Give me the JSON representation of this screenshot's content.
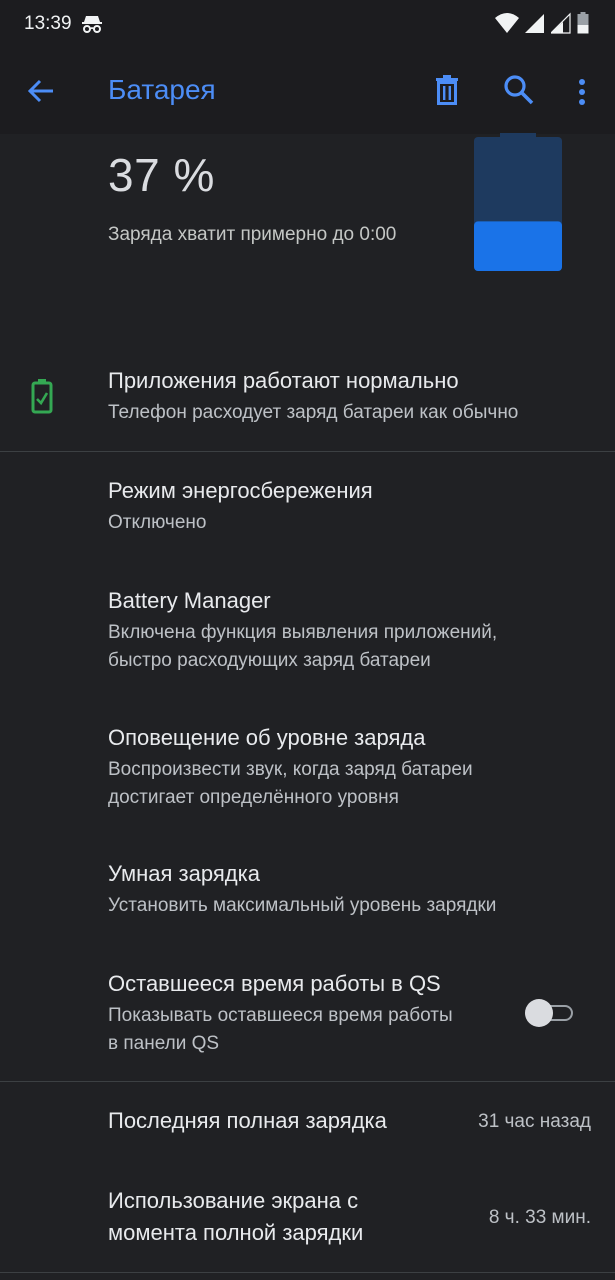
{
  "status_bar": {
    "time": "13:39",
    "icons": [
      "incognito-icon",
      "wifi-icon",
      "signal-icon",
      "signal-icon",
      "battery-icon"
    ]
  },
  "app_bar": {
    "title": "Батарея",
    "icons": [
      "back-arrow-icon",
      "trash-icon",
      "search-icon",
      "more-vert-icon"
    ]
  },
  "battery": {
    "percent": "37 %",
    "level": 0.37,
    "estimate": "Заряда хватит примерно до 0:00"
  },
  "status_item": {
    "title": "Приложения работают нормально",
    "subtitle": "Телефон расходует заряд батареи как обычно",
    "icon": "battery-check-icon"
  },
  "settings": [
    {
      "title": "Режим энергосбережения",
      "subtitle": [
        "Отключено"
      ]
    },
    {
      "title": "Battery Manager",
      "subtitle": [
        "Включена функция выявления приложений,",
        "быстро расходующих заряд батареи"
      ]
    },
    {
      "title": "Оповещение об уровне заряда",
      "subtitle": [
        "Воспроизвести звук, когда заряд батареи",
        "достигает определённого уровня"
      ]
    },
    {
      "title": "Умная зарядка",
      "subtitle": [
        "Установить максимальный уровень зарядки"
      ]
    },
    {
      "title": "Оставшееся время работы в QS",
      "subtitle": [
        "Показывать оставшееся время работы",
        "в панели QS"
      ],
      "toggle": false
    }
  ],
  "stats": [
    {
      "title": [
        "Последняя полная зарядка"
      ],
      "value": "31 час назад"
    },
    {
      "title": [
        "Использование экрана с",
        "момента полной зарядки"
      ],
      "value": "8 ч. 33 мин."
    }
  ],
  "colors": {
    "accent": "#4c8df6",
    "battery_fill": "#1a73e8",
    "battery_empty": "#1e3a5f",
    "ok_green": "#34a853",
    "background": "#202124"
  }
}
